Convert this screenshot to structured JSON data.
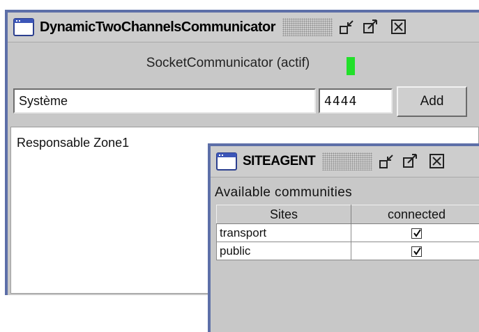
{
  "main_window": {
    "title": "DynamicTwoChannelsCommunicator",
    "status_label": "SocketCommunicator (actif)",
    "status_color": "#22e02a",
    "name_value": "Système",
    "port_value": "4444",
    "add_label": "Add",
    "log_lines": [
      "Responsable Zone1"
    ]
  },
  "site_window": {
    "title": "SITEAGENT",
    "subtitle": "Available communities",
    "columns": [
      "Sites",
      "connected"
    ],
    "rows": [
      {
        "site": "transport",
        "connected": true
      },
      {
        "site": "public",
        "connected": true
      }
    ]
  },
  "colors": {
    "window_border": "#5d6fa8",
    "window_bg": "#c8c8c8",
    "led_active": "#22e02a"
  },
  "icons": [
    "window-icon",
    "minimize-icon",
    "maximize-icon",
    "close-icon",
    "checkbox-checked-icon"
  ]
}
